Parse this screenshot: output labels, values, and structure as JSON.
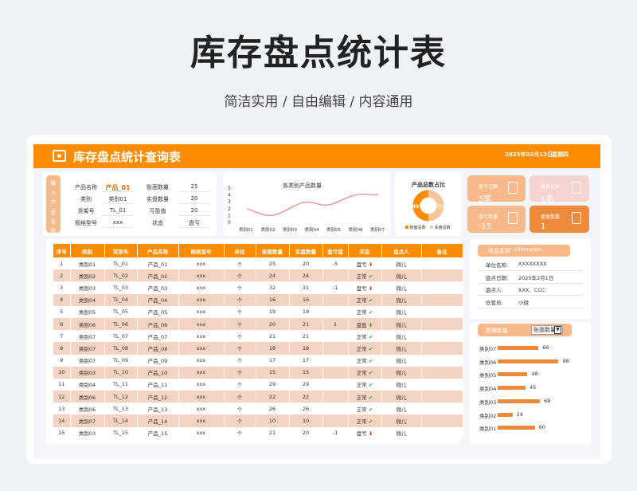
{
  "page_title": "库存盘点统计表",
  "subtitle": "简洁实用 / 自由编辑 / 内容通用",
  "window": {
    "title": "库存盘点统计查询表",
    "date": "2025年02月13日",
    "weekday": "星期四"
  },
  "input_panel": {
    "tab_label": [
      "输",
      "入",
      "产",
      "品",
      "名",
      "称"
    ],
    "fields": [
      {
        "label": "产品名称",
        "value": "产品_01",
        "label2": "账面数量",
        "value2": "25"
      },
      {
        "label": "类别",
        "value": "类别01",
        "label2": "实盘数量",
        "value2": "20"
      },
      {
        "label": "货架号",
        "value": "TL_01",
        "label2": "亏盈值",
        "value2": "20"
      },
      {
        "label": "规格型号",
        "value": "xxx",
        "label2": "状态",
        "value2": "盘亏"
      }
    ]
  },
  "line_chart": {
    "title": "各类别产品数量",
    "yticks": [
      "5",
      "4",
      "3",
      "2",
      "1",
      "0"
    ],
    "categories": [
      "类别01",
      "类别02",
      "类别03",
      "类别04",
      "类别05",
      "类别06",
      "类别07"
    ]
  },
  "donut": {
    "title": "产品总数占比",
    "slices": [
      {
        "name": "账面总数",
        "pct": "49%"
      },
      {
        "name": "实盘总数",
        "pct": "51%"
      }
    ]
  },
  "kpis": [
    {
      "label": "盘亏记录",
      "value": "5笔"
    },
    {
      "label": "盘盈记录",
      "value": "1笔"
    },
    {
      "label": "盘亏数量",
      "value": "-15"
    },
    {
      "label": "盘盈数量",
      "value": "1"
    }
  ],
  "table": {
    "headers": [
      "序号",
      "类别",
      "货架号",
      "产品名称",
      "规格型号",
      "单位",
      "账面数量",
      "实盘数量",
      "盈亏值",
      "状态",
      "盘点人",
      "备注"
    ],
    "rows": [
      [
        "1",
        "类别01",
        "TL_01",
        "产品_01",
        "xxx",
        "个",
        "25",
        "20",
        "-5",
        "盘亏",
        "dn",
        "微儿",
        ""
      ],
      [
        "2",
        "类别02",
        "TL_02",
        "产品_02",
        "xxx",
        "个",
        "24",
        "24",
        "",
        "正常",
        "up",
        "微儿",
        ""
      ],
      [
        "3",
        "类别03",
        "TL_03",
        "产品_03",
        "xxx",
        "个",
        "32",
        "31",
        "-1",
        "盘亏",
        "dn",
        "微儿",
        ""
      ],
      [
        "4",
        "类别04",
        "TL_04",
        "产品_04",
        "xxx",
        "个",
        "16",
        "16",
        "",
        "正常",
        "up",
        "微儿",
        ""
      ],
      [
        "5",
        "类别05",
        "TL_05",
        "产品_05",
        "xxx",
        "个",
        "19",
        "19",
        "",
        "正常",
        "up",
        "微儿",
        ""
      ],
      [
        "6",
        "类别06",
        "TL_06",
        "产品_06",
        "xxx",
        "个",
        "20",
        "21",
        "1",
        "盘盈",
        "upg",
        "微儿",
        ""
      ],
      [
        "7",
        "类别07",
        "TL_07",
        "产品_07",
        "xxx",
        "个",
        "21",
        "21",
        "",
        "正常",
        "up",
        "微儿",
        ""
      ],
      [
        "8",
        "类别07",
        "TL_08",
        "产品_08",
        "xxx",
        "个",
        "18",
        "18",
        "",
        "正常",
        "up",
        "微儿",
        ""
      ],
      [
        "9",
        "类别07",
        "TL_09",
        "产品_09",
        "xxx",
        "个",
        "17",
        "17",
        "",
        "正常",
        "up",
        "微儿",
        ""
      ],
      [
        "10",
        "类别03",
        "TL_10",
        "产品_10",
        "xxx",
        "个",
        "15",
        "15",
        "",
        "正常",
        "up",
        "微儿",
        ""
      ],
      [
        "11",
        "类别04",
        "TL_11",
        "产品_11",
        "xxx",
        "个",
        "29",
        "29",
        "",
        "正常",
        "up",
        "微儿",
        ""
      ],
      [
        "12",
        "类别06",
        "TL_12",
        "产品_12",
        "xxx",
        "个",
        "22",
        "22",
        "",
        "正常",
        "up",
        "微儿",
        ""
      ],
      [
        "13",
        "类别06",
        "TL_13",
        "产品_13",
        "xxx",
        "个",
        "26",
        "26",
        "",
        "正常",
        "up",
        "微儿",
        ""
      ],
      [
        "14",
        "类别07",
        "TL_14",
        "产品_14",
        "xxx",
        "个",
        "10",
        "10",
        "",
        "正常",
        "up",
        "微儿",
        ""
      ],
      [
        "15",
        "类别03",
        "TL_15",
        "产品_15",
        "xxx",
        "个",
        "21",
        "20",
        "-1",
        "盘亏",
        "dn",
        "微儿",
        ""
      ]
    ]
  },
  "info": {
    "head": "信息系列",
    "head_en": "Information",
    "rows": [
      {
        "label": "单位名称:",
        "value": "XXXXXXXX"
      },
      {
        "label": "盘点日期:",
        "value": "2025年2月1日"
      },
      {
        "label": "盘点人:",
        "value": "XXX、CCC"
      },
      {
        "label": "仓管员:",
        "value": "小微"
      }
    ]
  },
  "bar_panel": {
    "head": "数据数量",
    "select_value": "账面数量",
    "bars": [
      {
        "label": "类别07",
        "value": 66
      },
      {
        "label": "类别06",
        "value": 98
      },
      {
        "label": "类别05",
        "value": 48
      },
      {
        "label": "类别04",
        "value": 45
      },
      {
        "label": "类别03",
        "value": 68
      },
      {
        "label": "类别02",
        "value": 24
      },
      {
        "label": "类别01",
        "value": 60
      }
    ]
  },
  "colors": {
    "accent": "#ff8c00",
    "light": "#f7b98a",
    "row_alt": "#f5d3c3"
  }
}
